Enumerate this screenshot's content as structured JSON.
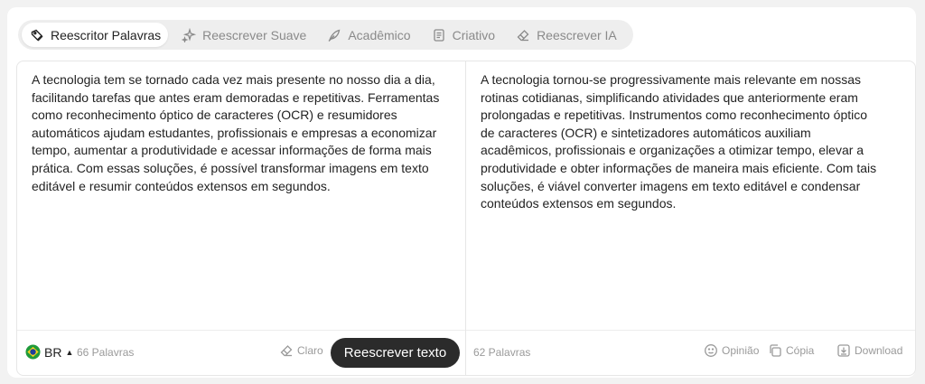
{
  "tabs": [
    {
      "label": "Reescritor Palavras",
      "icon": "pencil-tag-icon",
      "active": true
    },
    {
      "label": "Reescrever Suave",
      "icon": "sparkles-icon",
      "active": false
    },
    {
      "label": "Acadêmico",
      "icon": "feather-icon",
      "active": false
    },
    {
      "label": "Criativo",
      "icon": "book-icon",
      "active": false
    },
    {
      "label": "Reescrever IA",
      "icon": "eraser-icon",
      "active": false
    }
  ],
  "input": {
    "text": "A tecnologia tem se tornado cada vez mais presente no nosso dia a dia, facilitando tarefas que antes eram demoradas e repetitivas. Ferramentas como reconhecimento óptico de caracteres (OCR) e resumidores automáticos ajudam estudantes, profissionais e empresas a economizar tempo, aumentar a produtividade e acessar informações de forma mais prática. Com essas soluções, é possível transformar imagens em texto editável e resumir conteúdos extensos em segundos.",
    "language": "BR",
    "word_count": "66 Palavras",
    "clear_label": "Claro",
    "rewrite_label": "Reescrever texto"
  },
  "output": {
    "text": "A tecnologia tornou-se progressivamente mais relevante em nossas rotinas cotidianas, simplificando atividades que anteriormente eram prolongadas e repetitivas. Instrumentos como reconhecimento óptico de caracteres (OCR) e sintetizadores automáticos auxiliam acadêmicos, profissionais e organizações a otimizar tempo, elevar a produtividade e obter informações de maneira mais eficiente. Com tais soluções, é viável converter imagens em texto editável e condensar conteúdos extensos em segundos.",
    "word_count": "62 Palavras",
    "feedback_label": "Opinião",
    "copy_label": "Cópia",
    "download_label": "Download"
  },
  "colors": {
    "primary_button": "#2b2b2b",
    "muted_text": "#9a9a9a",
    "background": "#f2f2f2"
  }
}
